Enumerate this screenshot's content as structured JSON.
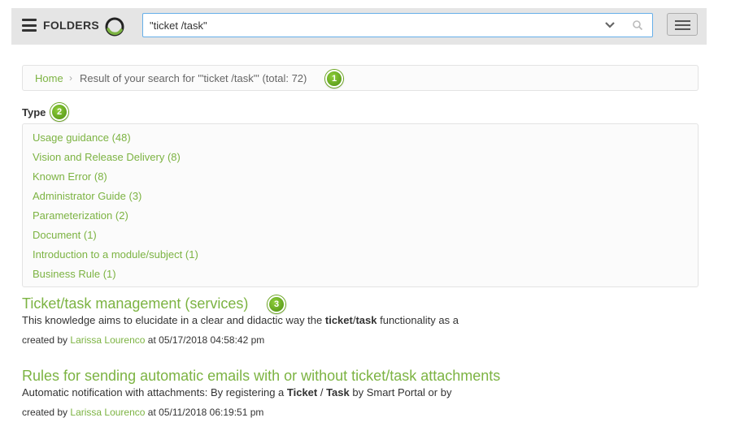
{
  "header": {
    "folders_label": "FOLDERS",
    "search_value": "\"ticket /task\""
  },
  "breadcrumb": {
    "home": "Home",
    "separator": "›",
    "current": "Result of your search for '\"ticket /task\"' (total: 72)"
  },
  "badges": {
    "b1": "1",
    "b2": "2",
    "b3": "3"
  },
  "type_filter": {
    "heading": "Type",
    "items": [
      "Usage guidance (48)",
      "Vision and Release Delivery (8)",
      "Known Error (8)",
      "Administrator Guide (3)",
      "Parameterization (2)",
      "Document (1)",
      "Introduction to a module/subject (1)",
      "Business Rule (1)"
    ]
  },
  "results": [
    {
      "title": "Ticket/task management (services)",
      "snippet_pre": "This knowledge aims to elucidate in a clear and didactic way the ",
      "snippet_bold1": "ticket",
      "snippet_mid": "/",
      "snippet_bold2": "task",
      "snippet_post": " functionality as a",
      "created_by_label": "created by",
      "author": "Larissa Lourenco",
      "at_label": "at",
      "date": "05/17/2018 04:58:42 pm"
    },
    {
      "title": "Rules for sending automatic emails with or without ticket/task attachments",
      "snippet_pre": "Automatic notification with attachments: By registering a ",
      "snippet_bold1": "Ticket",
      "snippet_mid": " / ",
      "snippet_bold2": "Task",
      "snippet_post": " by Smart Portal or by",
      "created_by_label": "created by",
      "author": "Larissa Lourenco",
      "at_label": "at",
      "date": "05/11/2018 06:19:51 pm"
    }
  ],
  "colors": {
    "accent_green": "#7cb342",
    "topbar_bg": "#e5e5e5",
    "badge_green": "#5a9e1a"
  }
}
